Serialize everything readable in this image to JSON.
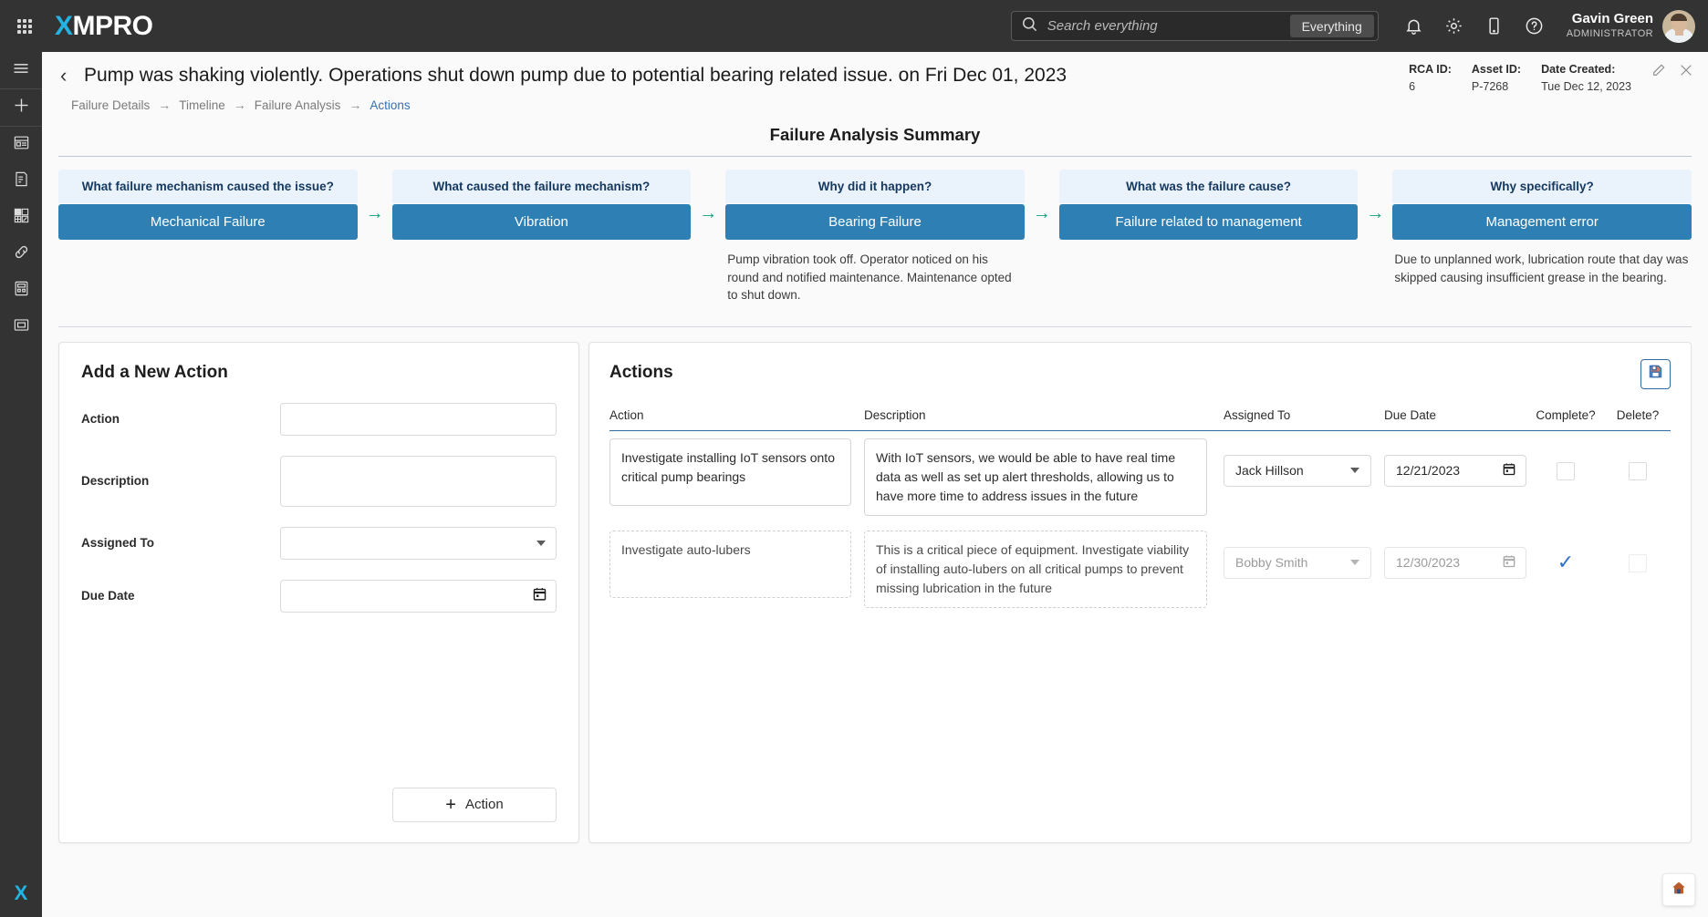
{
  "topbar": {
    "waffle_name": "apps-grid-icon",
    "brand_x": "X",
    "brand_rest": "MPRO",
    "search": {
      "placeholder": "Search everything",
      "value": "",
      "scope_button": "Everything"
    },
    "icons": [
      "bell-icon",
      "gear-icon",
      "mobile-icon",
      "help-icon"
    ],
    "user": {
      "name": "Gavin Green",
      "role": "ADMINISTRATOR"
    }
  },
  "sidebar": {
    "items": [
      {
        "name": "menu-icon"
      },
      {
        "name": "add-icon"
      },
      {
        "name": "dashboard-icon"
      },
      {
        "name": "report-icon"
      },
      {
        "name": "widgets-icon"
      },
      {
        "name": "link-icon"
      },
      {
        "name": "calculator-icon"
      },
      {
        "name": "form-icon"
      }
    ],
    "logo_x": "X"
  },
  "header": {
    "back_chevron": "‹",
    "title": "Pump was shaking violently. Operations shut down pump due to potential bearing related issue. on Fri Dec 01, 2023",
    "breadcrumb": [
      {
        "label": "Failure Details",
        "active": false
      },
      {
        "label": "Timeline",
        "active": false
      },
      {
        "label": "Failure Analysis",
        "active": false
      },
      {
        "label": "Actions",
        "active": true
      }
    ],
    "breadcrumb_arrow": "→",
    "meta": [
      {
        "label": "RCA ID:",
        "value": "6"
      },
      {
        "label": "Asset ID:",
        "value": "P-7268"
      },
      {
        "label": "Date Created:",
        "value": "Tue Dec 12, 2023"
      }
    ],
    "edit_icon": "pencil-icon",
    "close_icon": "close-icon"
  },
  "summary": {
    "title": "Failure Analysis Summary",
    "arrow": "→",
    "steps": [
      {
        "question": "What failure mechanism caused the issue?",
        "answer": "Mechanical Failure",
        "note": ""
      },
      {
        "question": "What caused the failure mechanism?",
        "answer": "Vibration",
        "note": ""
      },
      {
        "question": "Why did it happen?",
        "answer": "Bearing Failure",
        "note": "Pump vibration took off. Operator noticed on his round and notified maintenance. Maintenance opted to shut down."
      },
      {
        "question": "What was the failure cause?",
        "answer": "Failure related to management",
        "note": ""
      },
      {
        "question": "Why specifically?",
        "answer": "Management error",
        "note": "Due to unplanned work, lubrication route that day was skipped causing insufficient grease in the bearing."
      }
    ]
  },
  "add_action": {
    "title": "Add a New Action",
    "fields": {
      "action": {
        "label": "Action",
        "value": "",
        "placeholder": ""
      },
      "description": {
        "label": "Description",
        "value": "",
        "placeholder": ""
      },
      "assigned_to": {
        "label": "Assigned To",
        "value": "",
        "placeholder": ""
      },
      "due_date": {
        "label": "Due Date",
        "value": "",
        "placeholder": ""
      }
    },
    "submit_label": "Action",
    "submit_plus": "+"
  },
  "actions_panel": {
    "title": "Actions",
    "save_icon": "save-icon",
    "columns": [
      "Action",
      "Description",
      "Assigned To",
      "Due Date",
      "Complete?",
      "Delete?"
    ],
    "rows": [
      {
        "action": "Investigate installing IoT sensors onto critical pump bearings",
        "description": "With IoT sensors, we would be able to have real time data as well as set up alert thresholds, allowing us to have more time to address issues in the future",
        "assigned_to": "Jack Hillson",
        "due_date": "12/21/2023",
        "complete": false,
        "delete": false
      },
      {
        "action": "Investigate auto-lubers",
        "description": "This is a critical piece of equipment. Investigate viability of installing auto-lubers on all critical pumps to prevent missing lubrication in the future",
        "assigned_to": "Bobby Smith",
        "due_date": "12/30/2023",
        "complete": true,
        "delete": false
      }
    ],
    "check_glyph": "✓"
  },
  "fab": {
    "home_icon": "home-icon"
  },
  "colors": {
    "topbar_bg": "#333333",
    "brand_accent": "#24b2e0",
    "why_answer_bg": "#2e80b4",
    "why_question_bg": "#eaf2fb",
    "arrow_green": "#0fa27a",
    "link_blue": "#3a6fb0",
    "check_blue": "#2f72d0",
    "save_border": "#2e6da4"
  }
}
